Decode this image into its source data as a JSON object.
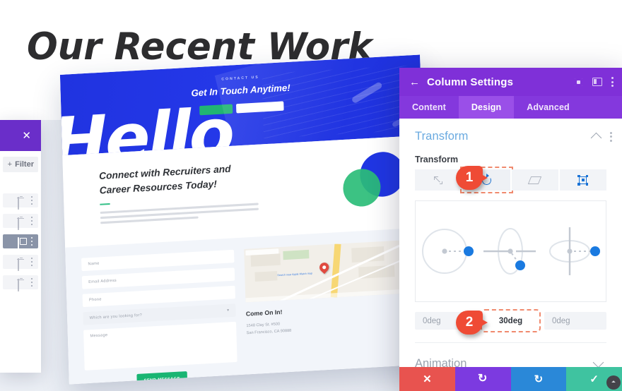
{
  "page": {
    "heading": "Our Recent Work"
  },
  "preview": {
    "hero": {
      "eyebrow": "CONTACT US",
      "title": "Get In Touch Anytime!",
      "button_primary": "",
      "button_secondary": "",
      "big_word": "Hello"
    },
    "section": {
      "heading": "Connect with Recruiters and Career Resources Today!"
    },
    "form": {
      "name_placeholder": "Name",
      "email_placeholder": "Email Address",
      "phone_placeholder": "Phone",
      "select_placeholder": "Which are you looking for?",
      "select_caret": "▾",
      "message_placeholder": "Message",
      "submit_label": "SEND MESSAGE"
    },
    "contact": {
      "heading": "Come On In!",
      "address_line1": "1548 Clay St. #500",
      "address_line2": "San Francisco, CA 90888",
      "map_directions": "Search near Apple Watch map"
    }
  },
  "left_panel": {
    "close_label": "✕",
    "filter_label": "Filter",
    "filter_plus": "+",
    "rows": [
      {
        "icon": "trash-icon",
        "selected": false
      },
      {
        "icon": "trash-icon",
        "selected": false
      },
      {
        "icon": "duplicate-icon",
        "selected": true
      },
      {
        "icon": "trash-icon",
        "selected": false
      },
      {
        "icon": "trash-icon",
        "selected": false
      }
    ]
  },
  "settings": {
    "header": {
      "back_glyph": "←",
      "title": "Column Settings",
      "icons": [
        "focus-icon",
        "layout-split-icon",
        "kebab-menu-icon"
      ]
    },
    "tabs": [
      {
        "label": "Content",
        "active": false
      },
      {
        "label": "Design",
        "active": true
      },
      {
        "label": "Advanced",
        "active": false
      }
    ],
    "transform_section": {
      "title": "Transform",
      "field_label": "Transform",
      "modes": [
        {
          "name": "scale-icon",
          "active": false
        },
        {
          "name": "rotate-icon",
          "active": true
        },
        {
          "name": "skew-icon",
          "active": false
        },
        {
          "name": "origin-icon",
          "active": false
        }
      ],
      "degree_inputs": [
        {
          "name": "rotate-x-input",
          "value": "0deg",
          "filled": false,
          "highlighted": false
        },
        {
          "name": "rotate-y-input",
          "value": "30deg",
          "filled": true,
          "highlighted": true
        },
        {
          "name": "rotate-z-input",
          "value": "0deg",
          "filled": false,
          "highlighted": false
        }
      ]
    },
    "animation_section": {
      "title": "Animation"
    },
    "action_bar": [
      {
        "name": "cancel-button",
        "glyph": "✕",
        "color": "#e8534f"
      },
      {
        "name": "undo-button",
        "glyph": "↺",
        "color": "#7c3ae0"
      },
      {
        "name": "redo-button",
        "glyph": "↻",
        "color": "#2a88d8"
      },
      {
        "name": "save-button",
        "glyph": "✓",
        "color": "#3fc3a0"
      }
    ]
  },
  "callouts": [
    {
      "number": "1",
      "target": "rotate-mode-button"
    },
    {
      "number": "2",
      "target": "rotate-y-input"
    }
  ]
}
